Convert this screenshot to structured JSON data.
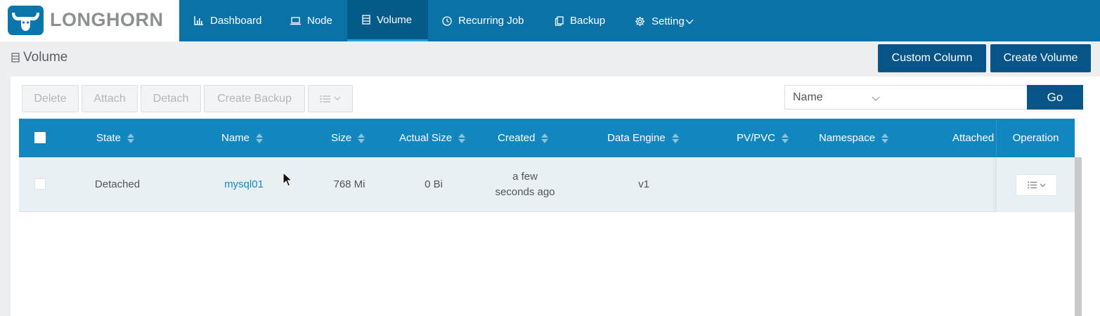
{
  "brand": {
    "name": "LONGHORN",
    "logo_icon": "longhorn-bull-icon",
    "logo_color": "#0b76ae"
  },
  "nav": {
    "items": [
      {
        "label": "Dashboard",
        "icon": "bar-chart-icon"
      },
      {
        "label": "Node",
        "icon": "laptop-icon"
      },
      {
        "label": "Volume",
        "icon": "database-icon",
        "active": true
      },
      {
        "label": "Recurring Job",
        "icon": "clock-icon"
      },
      {
        "label": "Backup",
        "icon": "copy-icon"
      },
      {
        "label": "Setting",
        "icon": "gear-icon",
        "suffix_icon": "chevron-down-icon"
      }
    ]
  },
  "page": {
    "title": "Volume",
    "title_icon": "database-icon",
    "custom_column_label": "Custom Column",
    "create_volume_label": "Create Volume"
  },
  "toolbar": {
    "delete_label": "Delete",
    "attach_label": "Attach",
    "detach_label": "Detach",
    "create_backup_label": "Create Backup",
    "more_icon": "list-icon"
  },
  "search": {
    "field_selected": "Name",
    "value": "",
    "go_label": "Go"
  },
  "table": {
    "columns": [
      "State",
      "Name",
      "Size",
      "Actual Size",
      "Created",
      "Data Engine",
      "PV/PVC",
      "Namespace",
      "Attached",
      "Operation"
    ],
    "rows": [
      {
        "state": "Detached",
        "name": "mysql01",
        "size": "768 Mi",
        "actual_size": "0 Bi",
        "created_line1": "a few",
        "created_line2": "seconds ago",
        "data_engine": "v1",
        "pv_pvc": "",
        "namespace": "",
        "attached": ""
      }
    ]
  },
  "colors": {
    "nav_bg": "#0a72a6",
    "nav_active": "#045b88",
    "primary_button": "#075587",
    "table_header": "#1286bf",
    "row_bg": "#e8f0f4",
    "link": "#1589c6"
  }
}
